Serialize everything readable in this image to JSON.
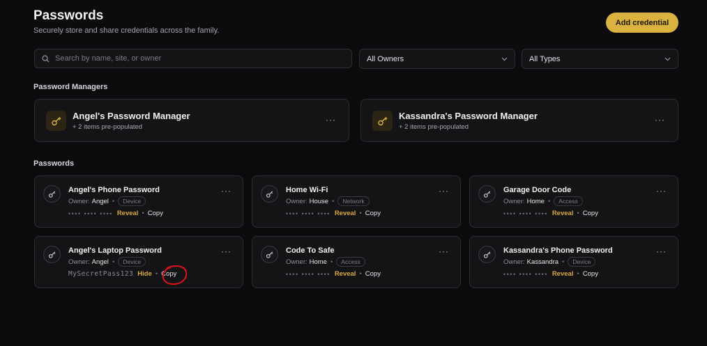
{
  "header": {
    "title": "Passwords",
    "subtitle": "Securely store and share credentials across the family.",
    "add_button": "Add credential"
  },
  "filters": {
    "search_placeholder": "Search by name, site, or owner",
    "owners_value": "All Owners",
    "types_value": "All Types"
  },
  "sections": {
    "managers": "Password Managers",
    "passwords": "Passwords"
  },
  "managers": [
    {
      "name": "Angel's Password Manager",
      "subtitle": "+ 2 items pre-populated"
    },
    {
      "name": "Kassandra's Password Manager",
      "subtitle": "+ 2 items pre-populated"
    }
  ],
  "labels": {
    "owner_prefix": "Owner:",
    "reveal": "Reveal",
    "hide": "Hide",
    "copy": "Copy",
    "masked": "•••• •••• ••••",
    "menu": "···",
    "dot_sep": "•"
  },
  "passwords": [
    {
      "name": "Angel's Phone Password",
      "owner": "Angel",
      "type": "Device",
      "revealed": false
    },
    {
      "name": "Home Wi-Fi",
      "owner": "House",
      "type": "Network",
      "revealed": false
    },
    {
      "name": "Garage Door Code",
      "owner": "Home",
      "type": "Access",
      "revealed": false
    },
    {
      "name": "Angel's Laptop Password",
      "owner": "Angel",
      "type": "Device",
      "revealed": true,
      "value": "MySecretPass123"
    },
    {
      "name": "Code To Safe",
      "owner": "Home",
      "type": "Access",
      "revealed": false
    },
    {
      "name": "Kassandra's Phone Password",
      "owner": "Kassandra",
      "type": "Device",
      "revealed": false
    }
  ],
  "colors": {
    "accent": "#d9b23f",
    "reveal_link": "#d9a93a",
    "background": "#0c0c0f",
    "card": "#141417",
    "annotation": "#e0141c"
  }
}
